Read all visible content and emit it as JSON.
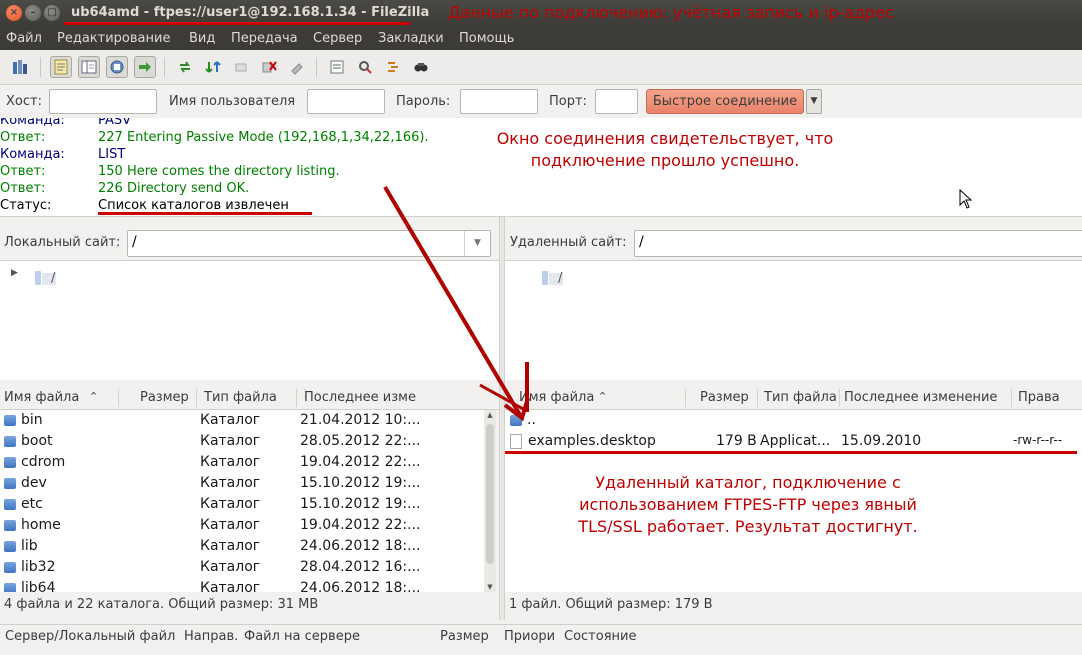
{
  "window": {
    "title": "ub64amd - ftpes://user1@192.168.1.34 - FileZilla",
    "annotation": "Данные по подключению: учётная запись и ip-адрес"
  },
  "menu": [
    "Файл",
    "Редактирование",
    "Вид",
    "Передача",
    "Сервер",
    "Закладки",
    "Помощь"
  ],
  "quickconnect": {
    "host_label": "Хост:",
    "user_label": "Имя пользователя",
    "password_label": "Пароль:",
    "port_label": "Порт:",
    "connect_label": "Быстрое соединение"
  },
  "log": [
    {
      "type": "Команда:",
      "message": "PASV",
      "kind": "cmd"
    },
    {
      "type": "Ответ:",
      "message": "227 Entering Passive Mode (192,168,1,34,22,166).",
      "kind": "ok"
    },
    {
      "type": "Команда:",
      "message": "LIST",
      "kind": "cmd"
    },
    {
      "type": "Ответ:",
      "message": "150 Here comes the directory listing.",
      "kind": "ok"
    },
    {
      "type": "Ответ:",
      "message": "226 Directory send OK.",
      "kind": "ok"
    },
    {
      "type": "Статус:",
      "message": "Список каталогов извлечен",
      "kind": "st"
    }
  ],
  "log_annotation": "Окно соединения свидетельствует, что подключение прошло успешно.",
  "local": {
    "site_label": "Локальный сайт:",
    "path": "/",
    "tree_item": "/",
    "headers": [
      "Имя файла",
      "Размер",
      "Тип файла",
      "Последнее изме"
    ],
    "files": [
      {
        "name": "bin",
        "type": "Каталог",
        "modified": "21.04.2012 10:..."
      },
      {
        "name": "boot",
        "type": "Каталог",
        "modified": "28.05.2012 22:..."
      },
      {
        "name": "cdrom",
        "type": "Каталог",
        "modified": "19.04.2012 22:..."
      },
      {
        "name": "dev",
        "type": "Каталог",
        "modified": "15.10.2012 19:..."
      },
      {
        "name": "etc",
        "type": "Каталог",
        "modified": "15.10.2012 19:..."
      },
      {
        "name": "home",
        "type": "Каталог",
        "modified": "19.04.2012 22:..."
      },
      {
        "name": "lib",
        "type": "Каталог",
        "modified": "24.06.2012 18:..."
      },
      {
        "name": "lib32",
        "type": "Каталог",
        "modified": "28.04.2012 16:..."
      },
      {
        "name": "lib64",
        "type": "Каталог",
        "modified": "24.06.2012 18:..."
      }
    ],
    "status": "4 файла и 22 каталога. Общий размер: 31 MB"
  },
  "remote": {
    "site_label": "Удаленный сайт:",
    "path": "/",
    "tree_item": "/",
    "headers": [
      "Имя файла",
      "Размер",
      "Тип файла",
      "Последнее изменение",
      "Права"
    ],
    "files": [
      {
        "name": "..",
        "size": "",
        "type": "",
        "modified": "",
        "perms": ""
      },
      {
        "name": "examples.desktop",
        "size": "179 B",
        "type": "Applicat...",
        "modified": "15.09.2010",
        "perms": "-rw-r--r--"
      }
    ],
    "status": "1 файл. Общий размер: 179 B",
    "annotation": "Удаленный каталог, подключение с использованием FTPES-FTP через явный TLS/SSL работает. Результат достигнут."
  },
  "queue_headers": [
    "Сервер/Локальный файл",
    "Направ.",
    "Файл на сервере",
    "Размер",
    "Приори",
    "Состояние"
  ],
  "colors": {
    "annotation": "#c10000",
    "accent_button": "#e8826a",
    "titlebar": "#3c3b37"
  }
}
